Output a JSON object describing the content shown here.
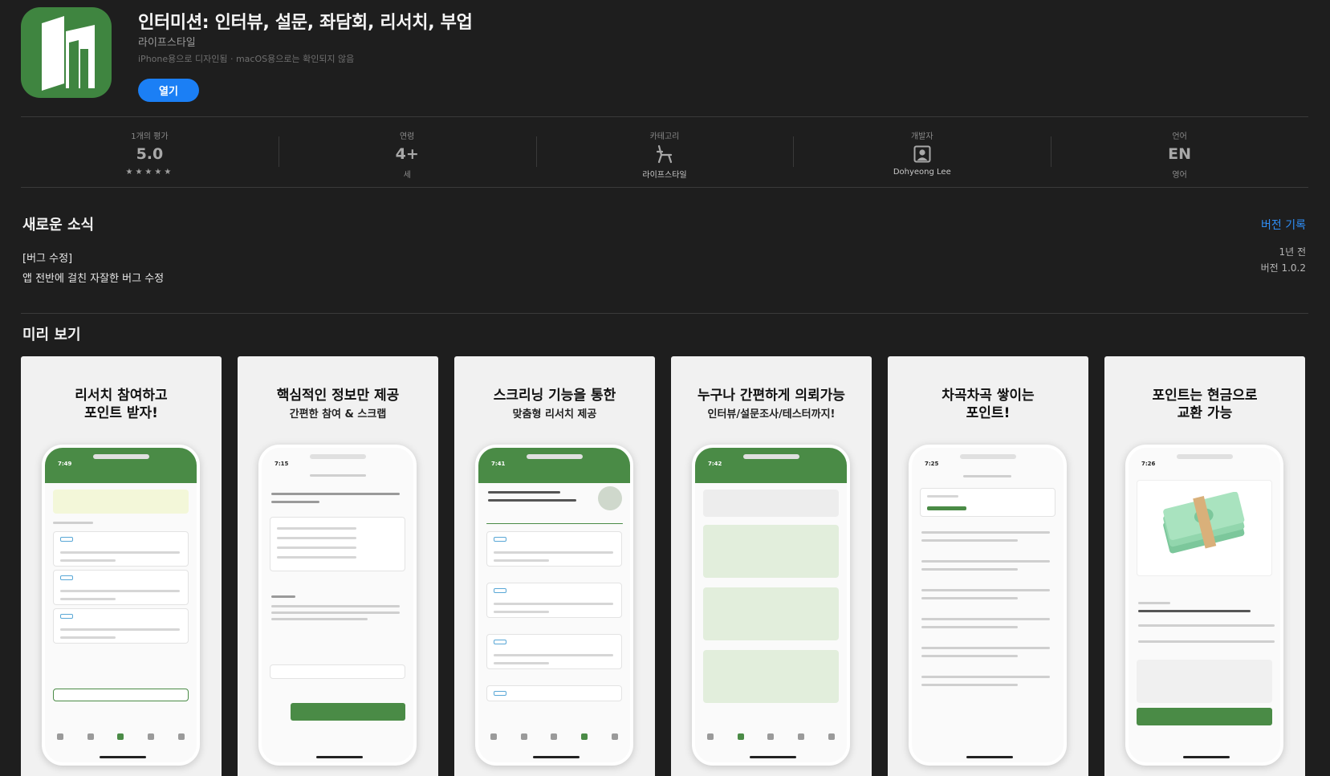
{
  "app": {
    "title": "인터미션: 인터뷰, 설문, 좌담회, 리서치, 부업",
    "category": "라이프스타일",
    "compatibility": "iPhone용으로 디자인됨 · macOS용으로는 확인되지 않음",
    "open_label": "열기",
    "brand_color": "#3f8540"
  },
  "stats": {
    "ratings": {
      "label": "1개의 평가",
      "value": "5.0",
      "stars": "★★★★★"
    },
    "age": {
      "label": "연령",
      "value": "4+",
      "sub": "세"
    },
    "category": {
      "label": "카테고리",
      "icon": "chair-icon",
      "sub": "라이프스타일"
    },
    "developer": {
      "label": "개발자",
      "icon": "person-icon",
      "sub": "Dohyeong Lee"
    },
    "language": {
      "label": "언어",
      "value": "EN",
      "sub": "영어"
    }
  },
  "news": {
    "title": "새로운 소식",
    "history_link": "버전 기록",
    "line1": "[버그 수정]",
    "line2": "앱 전반에 걸친 자잘한 버그 수정",
    "ago": "1년 전",
    "version": "버전 1.0.2"
  },
  "preview": {
    "title": "미리 보기",
    "cards": [
      {
        "h1": "리서치 참여하고",
        "h2": "포인트 받자!",
        "sub": ""
      },
      {
        "h1": "핵심적인 정보만 제공",
        "h2": "",
        "sub": "간편한 참여 & 스크랩"
      },
      {
        "h1": "스크리닝 기능을 통한",
        "h2": "",
        "sub": "맞춤형 리서치 제공"
      },
      {
        "h1": "누구나 간편하게 의뢰가능",
        "h2": "",
        "sub": "인터뷰/설문조사/테스터까지!"
      },
      {
        "h1": "차곡차곡 쌓이는",
        "h2": "포인트!",
        "sub": ""
      },
      {
        "h1": "포인트는 현금으로",
        "h2": "교환 가능",
        "sub": ""
      }
    ]
  }
}
